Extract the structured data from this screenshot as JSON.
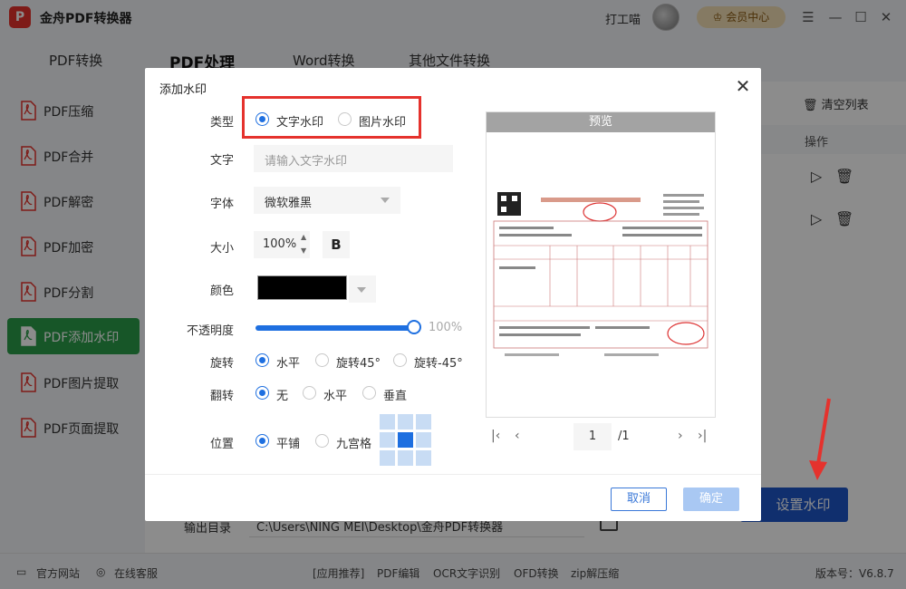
{
  "app": {
    "logo_text": "P",
    "title": "金舟PDF转换器",
    "username": "打工喵",
    "member_label": "会员中心",
    "controls": [
      "☰",
      "—",
      "☐",
      "✕"
    ]
  },
  "tabs": [
    "PDF转换",
    "PDF处理",
    "Word转换",
    "其他文件转换"
  ],
  "sidebar": {
    "items": [
      "PDF压缩",
      "PDF合并",
      "PDF解密",
      "PDF加密",
      "PDF分割",
      "PDF添加水印",
      "PDF图片提取",
      "PDF页面提取"
    ],
    "active_index": 5
  },
  "main": {
    "clear_list": "清空列表",
    "ops_header": "操作",
    "output_label": "输出目录",
    "output_path": "C:\\Users\\NING MEI\\Desktop\\金舟PDF转换器",
    "set_watermark_button": "设置水印"
  },
  "statusbar": {
    "official_site": "官方网站",
    "online_service": "在线客服",
    "recommend": "[应用推荐]",
    "links": [
      "PDF编辑",
      "OCR文字识别",
      "OFD转换",
      "zip解压缩"
    ],
    "version": "版本号：V6.8.7"
  },
  "dialog": {
    "title": "添加水印",
    "type_label": "类型",
    "type_options": [
      "文字水印",
      "图片水印"
    ],
    "type_selected": "文字水印",
    "text_label": "文字",
    "text_placeholder": "请输入文字水印",
    "font_label": "字体",
    "font_value": "微软雅黑",
    "size_label": "大小",
    "size_value": "100%",
    "bold_label": "B",
    "color_label": "颜色",
    "color_value": "#000000",
    "opacity_label": "不透明度",
    "opacity_value": "100%",
    "rotate_label": "旋转",
    "rotate_options": [
      "水平",
      "旋转45°",
      "旋转-45°"
    ],
    "rotate_selected": "水平",
    "flip_label": "翻转",
    "flip_options": [
      "无",
      "水平",
      "垂直"
    ],
    "flip_selected": "无",
    "position_label": "位置",
    "position_options": [
      "平铺",
      "九宫格"
    ],
    "position_selected": "平铺",
    "grid_selected_cell": 4,
    "preview_title": "预览",
    "page_current": "1",
    "page_total": "/1",
    "cancel_label": "取消",
    "ok_label": "确定"
  },
  "accent_colors": {
    "brand_green": "#2a9d4a",
    "primary_blue": "#1e56c9",
    "annotation_red": "#e5322d"
  }
}
